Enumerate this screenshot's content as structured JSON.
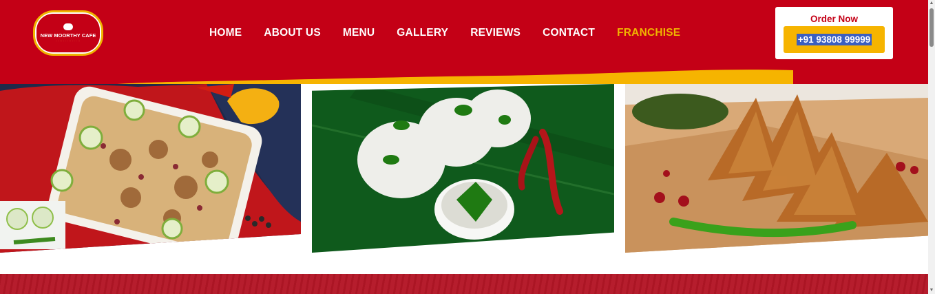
{
  "brand": {
    "name": "NEW MOORTHY CAFE",
    "colors": {
      "primary": "#c40016",
      "accent": "#f0b400",
      "highlight": "#3b5fc0"
    }
  },
  "nav": {
    "items": [
      {
        "label": "HOME"
      },
      {
        "label": "ABOUT US"
      },
      {
        "label": "MENU"
      },
      {
        "label": "GALLERY"
      },
      {
        "label": "REVIEWS"
      },
      {
        "label": "CONTACT"
      },
      {
        "label": "FRANCHISE",
        "active": true
      }
    ]
  },
  "order": {
    "title": "Order Now",
    "phone": "+91 93808 99999"
  },
  "gallery": {
    "images": [
      {
        "icon": "biryani-image"
      },
      {
        "icon": "idli-image"
      },
      {
        "icon": "samosa-image"
      }
    ]
  }
}
